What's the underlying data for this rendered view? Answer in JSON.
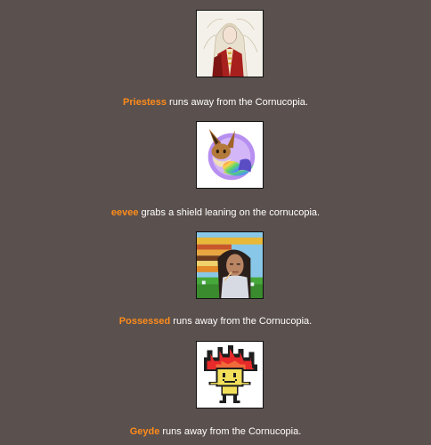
{
  "events": [
    {
      "tribute": "Priestess",
      "action": " runs away from the Cornucopia.",
      "avatar_icon": "priestess-portrait"
    },
    {
      "tribute": "eevee",
      "action": " grabs a shield leaning on the cornucopia.",
      "avatar_icon": "eevee-portrait"
    },
    {
      "tribute": "Possessed",
      "action": " runs away from the Cornucopia.",
      "avatar_icon": "possessed-portrait"
    },
    {
      "tribute": "Geyde",
      "action": " runs away from the Cornucopia.",
      "avatar_icon": "geyde-portrait"
    }
  ],
  "colors": {
    "background": "#5a504e",
    "name": "#ff8c1a",
    "text": "#ffffff"
  }
}
